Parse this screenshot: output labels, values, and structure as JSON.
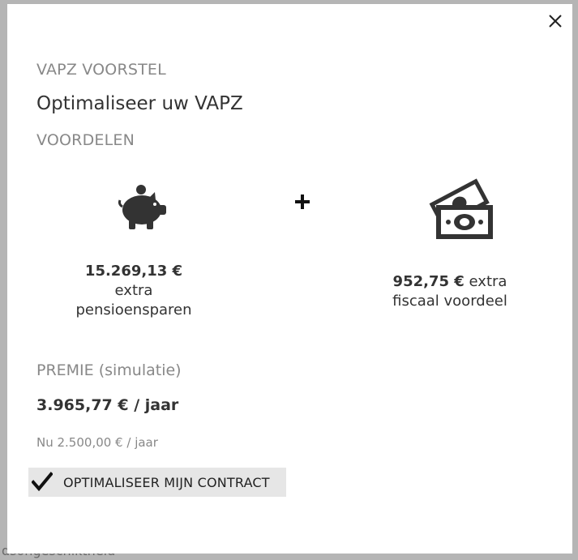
{
  "modal": {
    "section_label": "VAPZ VOORSTEL",
    "title": "Optimaliseer uw VAPZ",
    "benefits_label": "VOORDELEN",
    "benefit_1": {
      "icon": "piggy-bank-icon",
      "amount": "15.269,13 €",
      "line1": "extra",
      "line2": "pensioensparen"
    },
    "plus_symbol": "plus-icon",
    "benefit_2": {
      "icon": "money-bills-icon",
      "amount": "952,75 €",
      "suffix": " extra",
      "line2": "fiscaal voordeel"
    },
    "premium_label": "PREMIE (simulatie)",
    "premium_value": "3.965,77 € / jaar",
    "premium_current": "Nu 2.500,00 € / jaar",
    "optimize_button": "OPTIMALISEER MIJN CONTRACT",
    "close_icon": "close-icon"
  },
  "background": {
    "bottom_text": "dsongeschiktheid"
  },
  "colors": {
    "overlay": "#8a8a8a",
    "muted_text": "#888888",
    "dark_text": "#333333",
    "button_bg": "#e6e6e6",
    "accent_yellow": "#e0b000"
  }
}
